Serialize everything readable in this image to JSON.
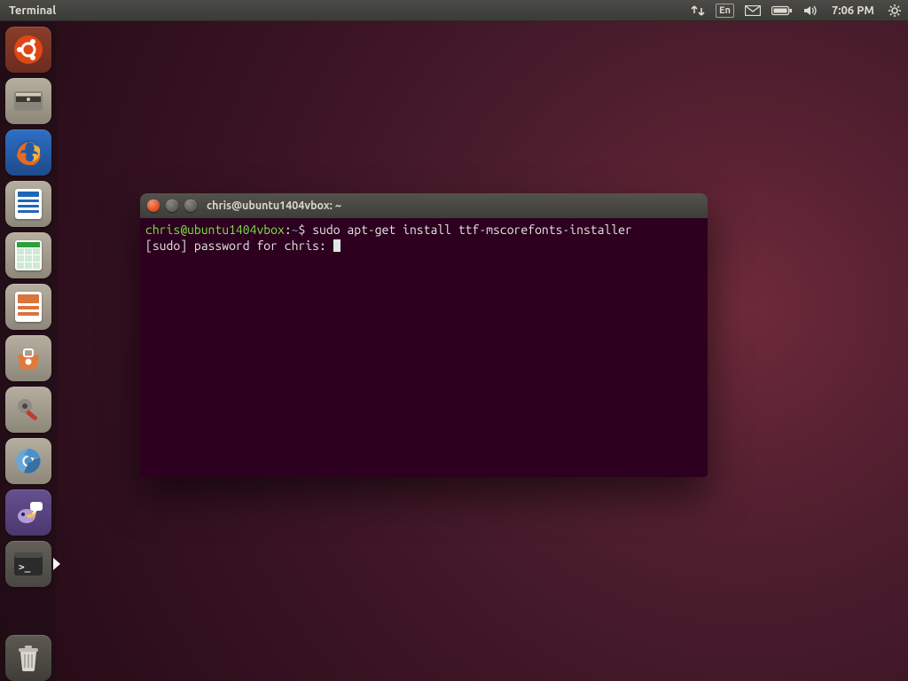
{
  "panel": {
    "app_label": "Terminal",
    "lang": "En",
    "clock": "7:06 PM"
  },
  "launcher": {
    "items": [
      {
        "name": "dash",
        "label": "Dash"
      },
      {
        "name": "files",
        "label": "Files"
      },
      {
        "name": "firefox",
        "label": "Firefox"
      },
      {
        "name": "writer",
        "label": "LibreOffice Writer"
      },
      {
        "name": "calc",
        "label": "LibreOffice Calc"
      },
      {
        "name": "impress",
        "label": "LibreOffice Impress"
      },
      {
        "name": "software",
        "label": "Ubuntu Software Center"
      },
      {
        "name": "settings",
        "label": "System Settings"
      },
      {
        "name": "chromium",
        "label": "Chromium"
      },
      {
        "name": "pidgin",
        "label": "Pidgin"
      },
      {
        "name": "terminal",
        "label": "Terminal",
        "active": true
      },
      {
        "name": "trash",
        "label": "Trash"
      }
    ]
  },
  "terminal": {
    "title": "chris@ubuntu1404vbox: ~",
    "prompt": {
      "userhost": "chris@ubuntu1404vbox",
      "cwd": "~",
      "sep1": ":",
      "sep2": "$"
    },
    "command": "sudo apt-get install ttf-mscorefonts-installer",
    "line2": "[sudo] password for chris: "
  }
}
